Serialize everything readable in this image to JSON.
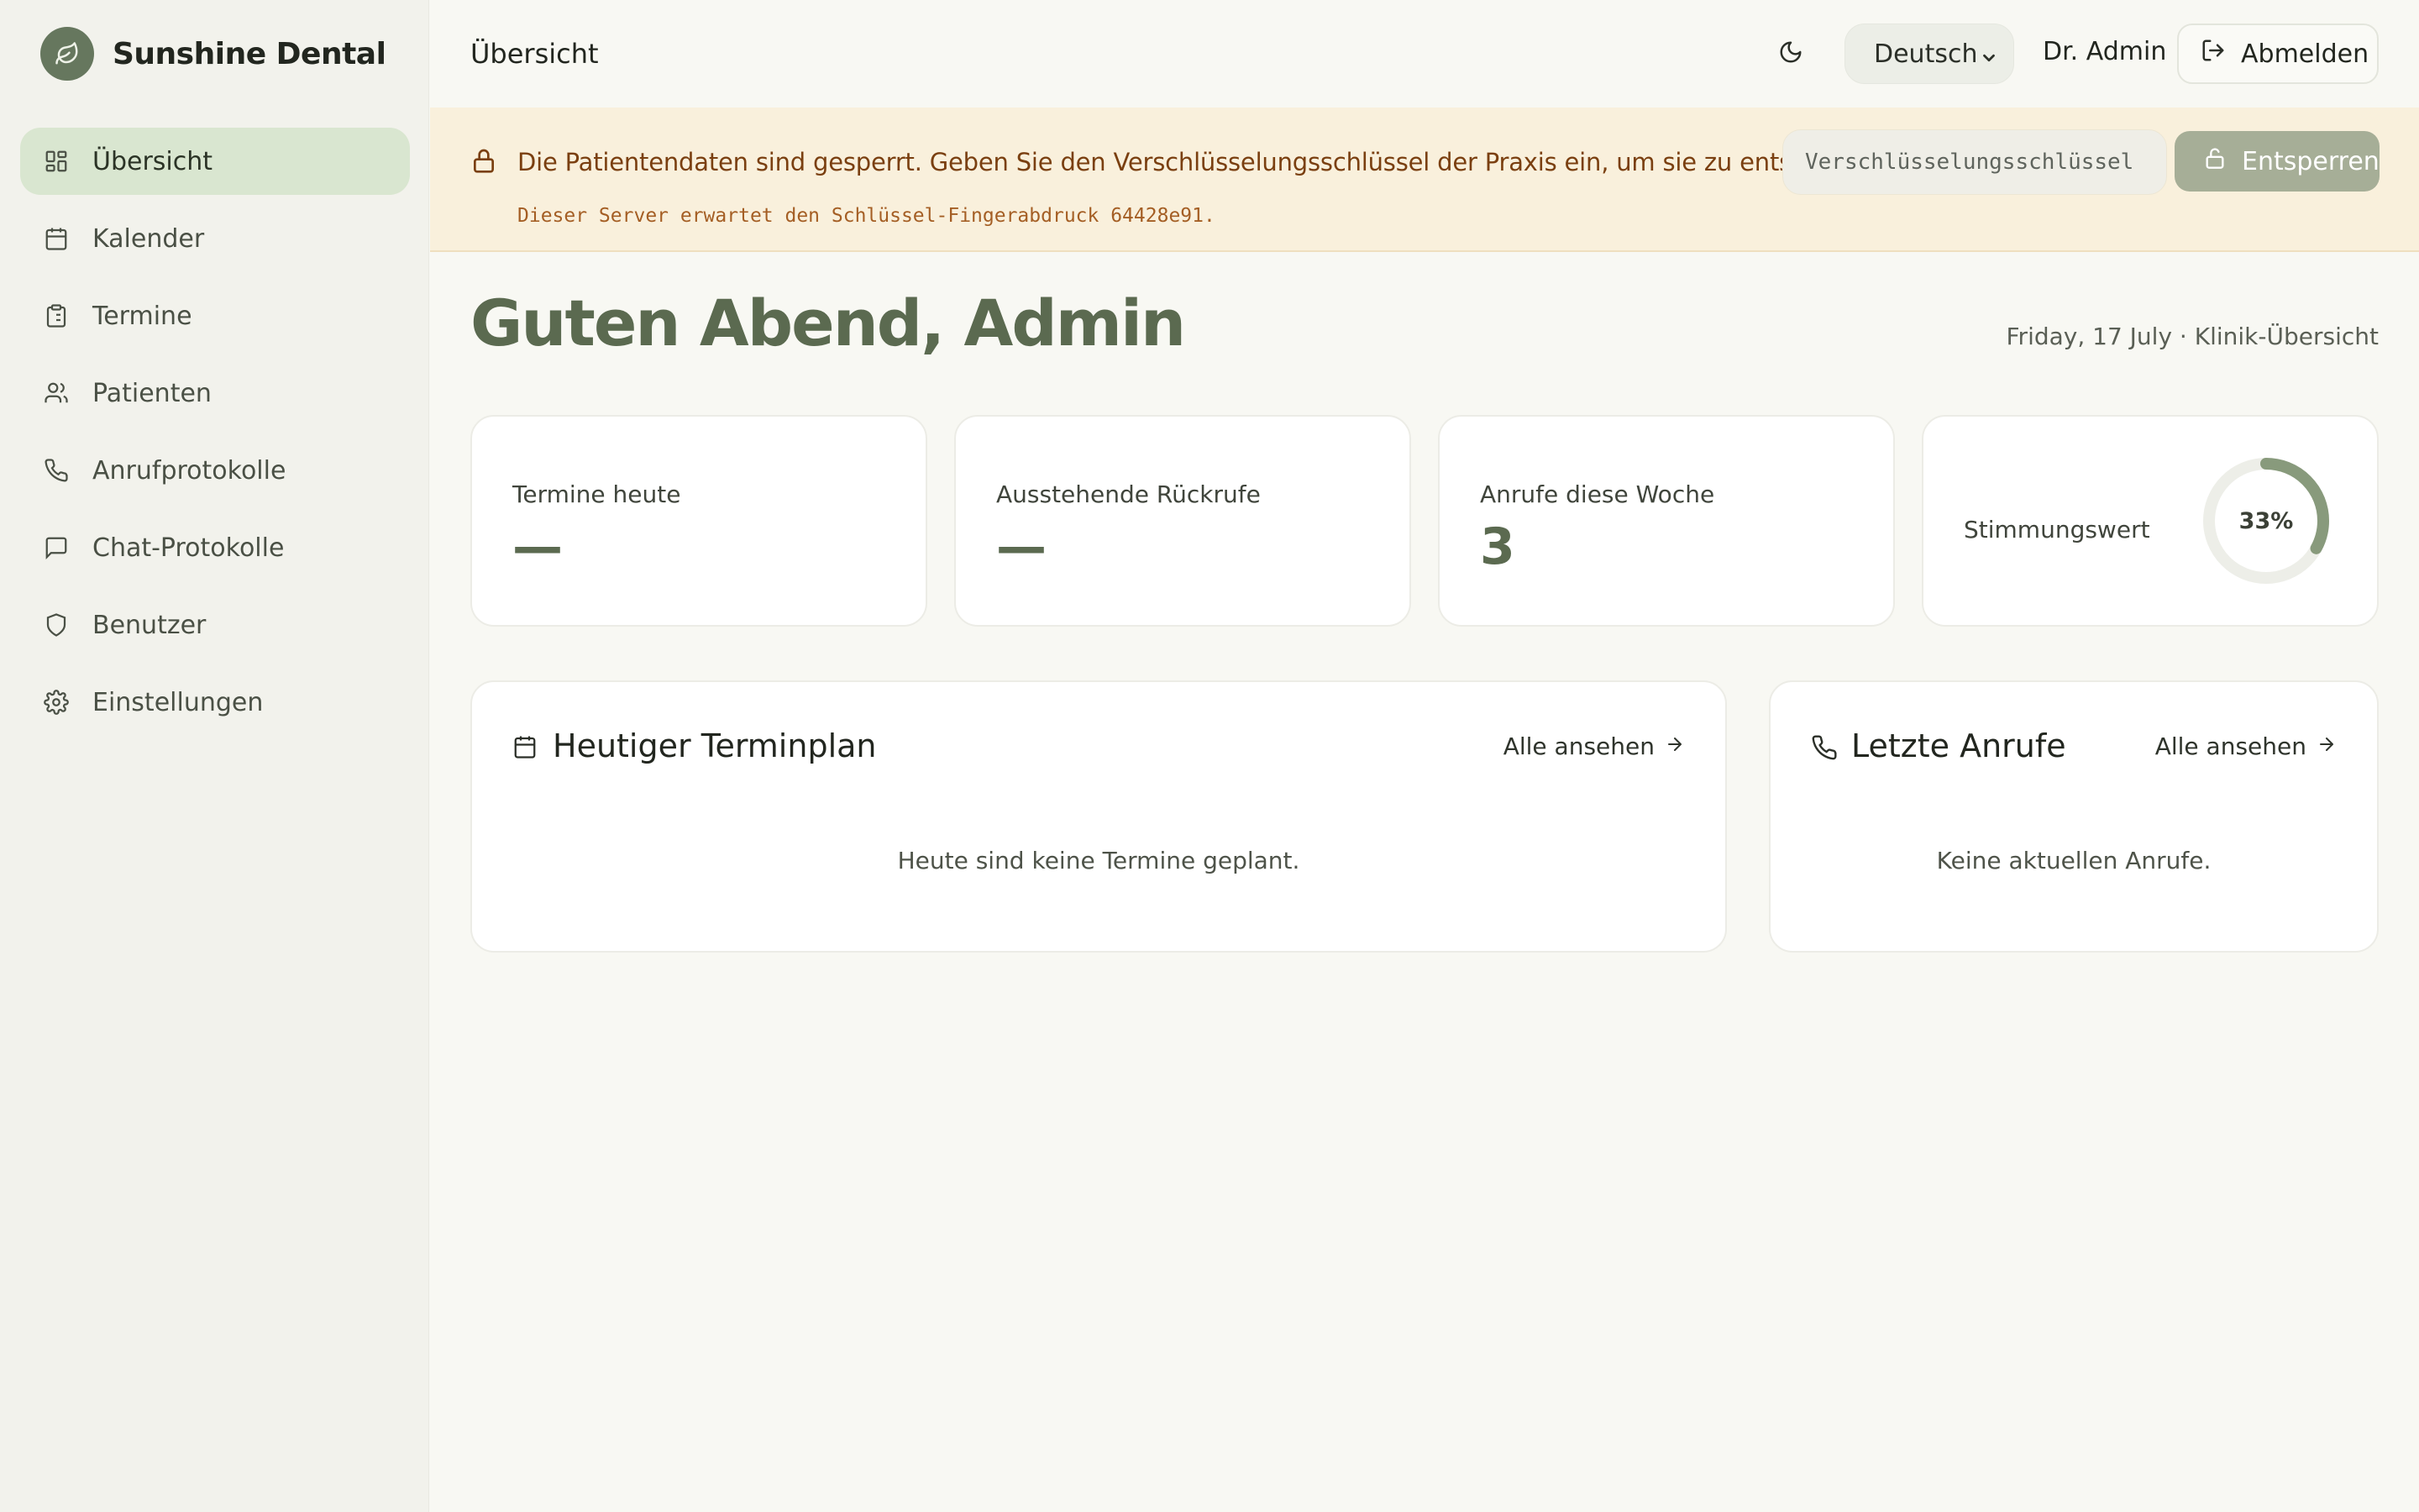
{
  "brand": {
    "name": "Sunshine Dental",
    "logo_icon": "leaf-icon"
  },
  "sidebar": {
    "items": [
      {
        "label": "Übersicht",
        "icon": "grid-icon",
        "active": true
      },
      {
        "label": "Kalender",
        "icon": "calendar-icon"
      },
      {
        "label": "Termine",
        "icon": "clipboard-icon"
      },
      {
        "label": "Patienten",
        "icon": "users-icon"
      },
      {
        "label": "Anrufprotokolle",
        "icon": "phone-icon"
      },
      {
        "label": "Chat-Protokolle",
        "icon": "chat-icon"
      },
      {
        "label": "Benutzer",
        "icon": "shield-icon"
      },
      {
        "label": "Einstellungen",
        "icon": "gear-icon"
      }
    ]
  },
  "header": {
    "title": "Übersicht",
    "language": "Deutsch",
    "user": "Dr. Admin",
    "logout_label": "Abmelden"
  },
  "banner": {
    "message": "Die Patientendaten sind gesperrt. Geben Sie den Verschlüsselungsschlüssel der Praxis ein, um sie zu entsperren.",
    "sub": "Dieser Server erwartet den Schlüssel-Fingerabdruck 64428e91.",
    "input_placeholder": "Verschlüsselungsschlüssel",
    "unlock_label": "Entsperren"
  },
  "greeting": "Guten Abend, Admin",
  "date_line": "Friday, 17 July · Klinik-Übersicht",
  "stats": [
    {
      "label": "Termine heute",
      "value": "—"
    },
    {
      "label": "Ausstehende Rückrufe",
      "value": "—"
    },
    {
      "label": "Anrufe diese Woche",
      "value": "3"
    }
  ],
  "sentiment": {
    "label": "Stimmungswert",
    "value_text": "33%",
    "fraction": 0.33
  },
  "schedule_panel": {
    "title": "Heutiger Terminplan",
    "link": "Alle ansehen",
    "empty": "Heute sind keine Termine geplant."
  },
  "calls_panel": {
    "title": "Letzte Anrufe",
    "link": "Alle ansehen",
    "empty": "Keine aktuellen Anrufe."
  },
  "colors": {
    "accent": "#5b6a50",
    "active_nav": "#d9e6d0",
    "banner_bg": "#f9f0dc",
    "banner_text": "#7a3f10",
    "unlock_button": "#a6ae97"
  }
}
